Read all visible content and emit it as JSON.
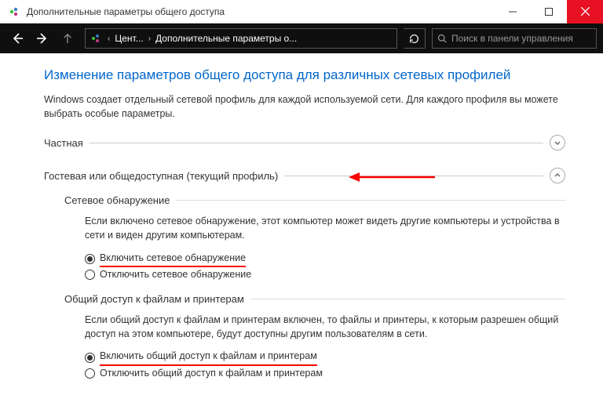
{
  "window": {
    "title": "Дополнительные параметры общего доступа"
  },
  "nav": {
    "crumb1": "Цент...",
    "crumb2": "Дополнительные параметры о...",
    "search_placeholder": "Поиск в панели управления"
  },
  "page": {
    "title": "Изменение параметров общего доступа для различных сетевых профилей",
    "desc": "Windows создает отдельный сетевой профиль для каждой используемой сети. Для каждого профиля вы можете выбрать особые параметры."
  },
  "profiles": {
    "private": "Частная",
    "guest": "Гостевая или общедоступная (текущий профиль)"
  },
  "network_discovery": {
    "title": "Сетевое обнаружение",
    "desc": "Если включено сетевое обнаружение, этот компьютер может видеть другие компьютеры и устройства в сети и виден другим компьютерам.",
    "enable": "Включить сетевое обнаружение",
    "disable": "Отключить сетевое обнаружение"
  },
  "file_sharing": {
    "title": "Общий доступ к файлам и принтерам",
    "desc": "Если общий доступ к файлам и принтерам включен, то файлы и принтеры, к которым разрешен общий доступ на этом компьютере, будут доступны другим пользователям в сети.",
    "enable": "Включить общий доступ к файлам и принтерам",
    "disable": "Отключить общий доступ к файлам и принтерам"
  }
}
